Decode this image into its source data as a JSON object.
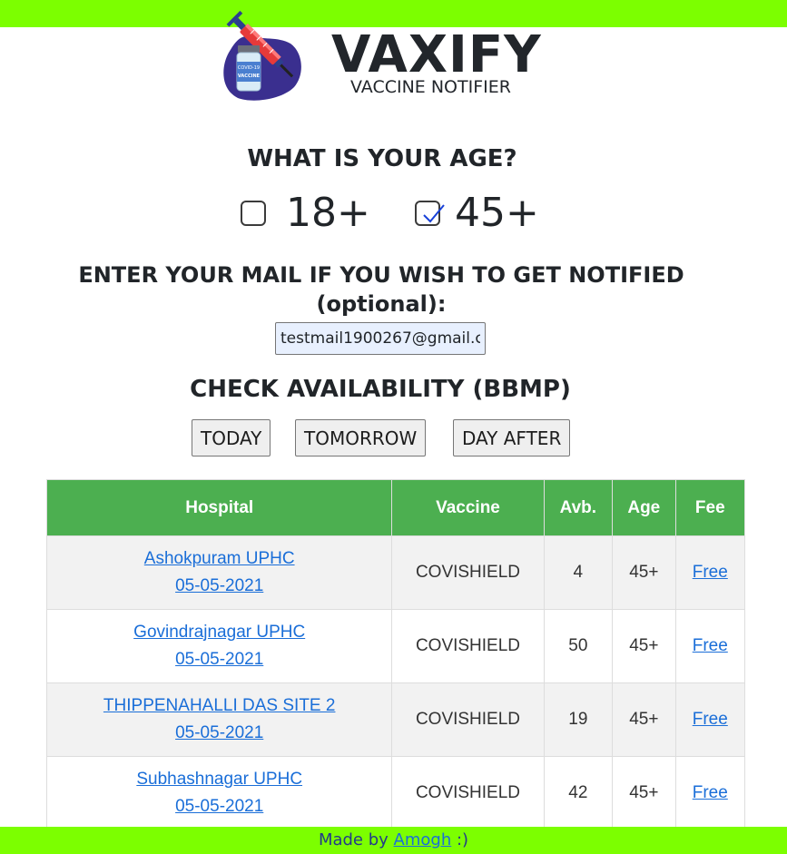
{
  "brand": {
    "title": "VAXIFY",
    "subtitle": "VACCINE NOTIFIER"
  },
  "age": {
    "heading": "WHAT IS YOUR AGE?",
    "options": [
      {
        "label": "18+",
        "checked": false
      },
      {
        "label": "45+",
        "checked": true
      }
    ]
  },
  "mail": {
    "heading_line1": "ENTER YOUR MAIL IF YOU WISH TO GET NOTIFIED",
    "heading_line2": "(optional):",
    "value": "testmail1900267@gmail.c"
  },
  "availability": {
    "heading": "CHECK AVAILABILITY (BBMP)",
    "buttons": [
      "TODAY",
      "TOMORROW",
      "DAY AFTER"
    ]
  },
  "table": {
    "headers": [
      "Hospital",
      "Vaccine",
      "Avb.",
      "Age",
      "Fee"
    ],
    "rows": [
      {
        "hospital": "Ashokpuram UPHC",
        "date": "05-05-2021",
        "vaccine": "COVISHIELD",
        "available": "4",
        "age": "45+",
        "fee": "Free"
      },
      {
        "hospital": "Govindrajnagar UPHC",
        "date": "05-05-2021",
        "vaccine": "COVISHIELD",
        "available": "50",
        "age": "45+",
        "fee": "Free"
      },
      {
        "hospital": "THIPPENAHALLI DAS SITE 2",
        "date": "05-05-2021",
        "vaccine": "COVISHIELD",
        "available": "19",
        "age": "45+",
        "fee": "Free"
      },
      {
        "hospital": "Subhashnagar UPHC",
        "date": "05-05-2021",
        "vaccine": "COVISHIELD",
        "available": "42",
        "age": "45+",
        "fee": "Free"
      }
    ]
  },
  "footer": {
    "prefix": "Made by ",
    "author": "Amogh",
    "suffix": " :)"
  },
  "logo": {
    "vial_text": "VACCINE",
    "vial_small": "COVID-19"
  },
  "colors": {
    "accent_bar": "#7cff00",
    "table_header": "#4caf50",
    "link": "#1a6ed8",
    "check": "#1740d8"
  }
}
